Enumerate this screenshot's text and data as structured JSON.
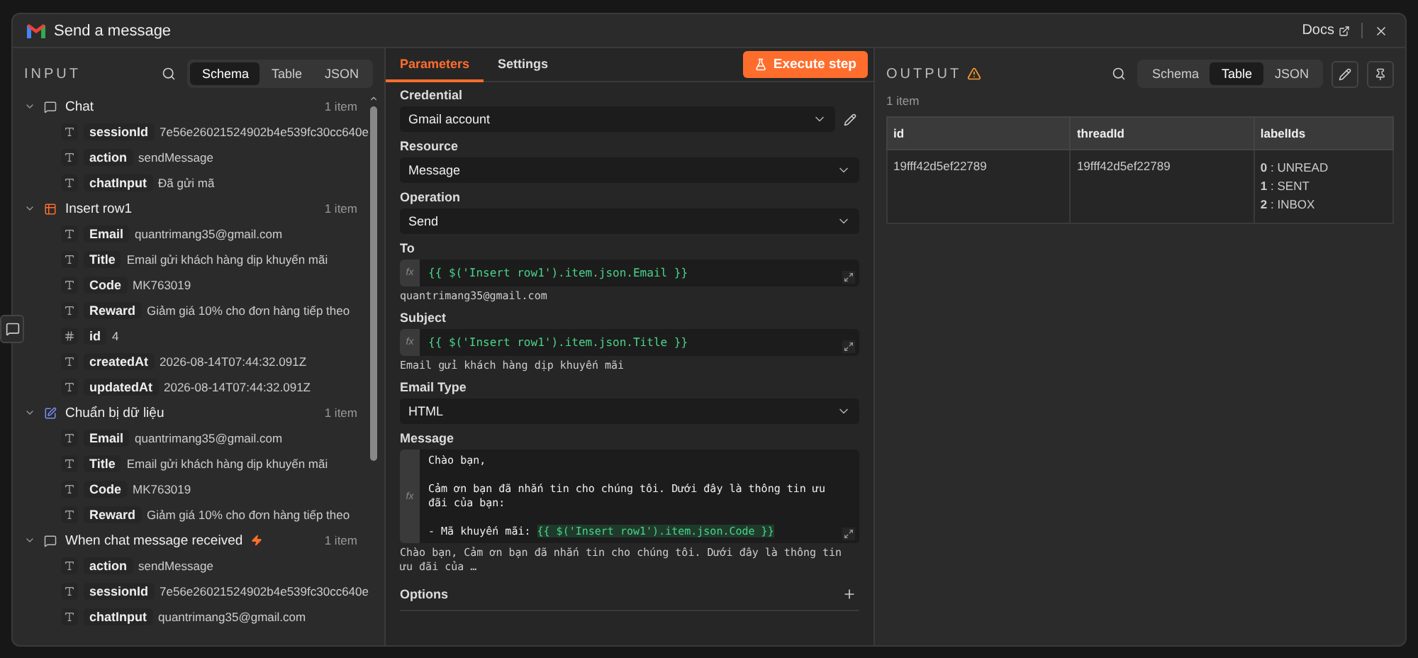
{
  "modal": {
    "title": "Send a message",
    "docs_link": "Docs"
  },
  "input": {
    "heading": "INPUT",
    "view_tabs": [
      {
        "label": "Schema",
        "selected": true
      },
      {
        "label": "Table",
        "selected": false
      },
      {
        "label": "JSON",
        "selected": false
      }
    ],
    "groups": [
      {
        "name": "Chat",
        "kind": "chat",
        "count": "1 item",
        "expanded": true,
        "fields": [
          {
            "kind": "string",
            "key": "sessionId",
            "value": "7e56e26021524902b4e539fc30cc640e"
          },
          {
            "kind": "string",
            "key": "action",
            "value": "sendMessage"
          },
          {
            "kind": "string",
            "key": "chatInput",
            "value": "Đã gửi mã"
          }
        ]
      },
      {
        "name": "Insert row1",
        "kind": "table",
        "count": "1 item",
        "expanded": true,
        "fields": [
          {
            "kind": "string",
            "key": "Email",
            "value": "quantrimang35@gmail.com"
          },
          {
            "kind": "string",
            "key": "Title",
            "value": "Email gửi khách hàng dịp khuyến mãi"
          },
          {
            "kind": "string",
            "key": "Code",
            "value": "MK763019"
          },
          {
            "kind": "string",
            "key": "Reward",
            "value": "Giảm giá 10% cho đơn hàng tiếp theo"
          },
          {
            "kind": "number",
            "key": "id",
            "value": "4"
          },
          {
            "kind": "string",
            "key": "createdAt",
            "value": "2026-08-14T07:44:32.091Z"
          },
          {
            "kind": "string",
            "key": "updatedAt",
            "value": "2026-08-14T07:44:32.091Z"
          }
        ]
      },
      {
        "name": "Chuẩn bị dữ liệu",
        "kind": "edit",
        "count": "1 item",
        "expanded": true,
        "fields": [
          {
            "kind": "string",
            "key": "Email",
            "value": "quantrimang35@gmail.com"
          },
          {
            "kind": "string",
            "key": "Title",
            "value": "Email gửi khách hàng dịp khuyến mãi"
          },
          {
            "kind": "string",
            "key": "Code",
            "value": "MK763019"
          },
          {
            "kind": "string",
            "key": "Reward",
            "value": "Giảm giá 10% cho đơn hàng tiếp theo"
          }
        ]
      },
      {
        "name": "When chat message received",
        "kind": "trigger",
        "count": "1 item",
        "expanded": true,
        "fields": [
          {
            "kind": "string",
            "key": "action",
            "value": "sendMessage"
          },
          {
            "kind": "string",
            "key": "sessionId",
            "value": "7e56e26021524902b4e539fc30cc640e"
          },
          {
            "kind": "string",
            "key": "chatInput",
            "value": "quantrimang35@gmail.com"
          }
        ]
      }
    ]
  },
  "parameters": {
    "tabs": [
      {
        "label": "Parameters",
        "selected": true
      },
      {
        "label": "Settings",
        "selected": false
      }
    ],
    "execute_button": "Execute step",
    "fields": [
      {
        "kind": "select",
        "label": "Credential",
        "value": "Gmail account",
        "editable": true
      },
      {
        "kind": "select",
        "label": "Resource",
        "value": "Message",
        "editable": false
      },
      {
        "kind": "select",
        "label": "Operation",
        "value": "Send",
        "editable": false
      },
      {
        "kind": "expression",
        "label": "To",
        "value": "{{ $('Insert row1').item.json.Email }}",
        "mode_label": "fx",
        "preview": "quantrimang35@gmail.com"
      },
      {
        "kind": "expression",
        "label": "Subject",
        "value": "{{ $('Insert row1').item.json.Title }}",
        "mode_label": "fx",
        "preview": "Email gửi khách hàng dịp khuyến mãi"
      },
      {
        "kind": "select",
        "label": "Email Type",
        "value": "HTML",
        "editable": false
      },
      {
        "kind": "code",
        "label": "Message",
        "lines": [
          {
            "kind": "text",
            "segments": [
              {
                "kind": "plain",
                "text": "Chào bạn,"
              }
            ]
          },
          {
            "kind": "blank"
          },
          {
            "kind": "text",
            "segments": [
              {
                "kind": "plain",
                "text": "Cảm ơn bạn đã nhắn tin cho chúng tôi. Dưới đây là thông tin ưu đãi của bạn:"
              }
            ]
          },
          {
            "kind": "blank"
          },
          {
            "kind": "text",
            "segments": [
              {
                "kind": "plain",
                "text": "- Mã khuyến mãi: "
              },
              {
                "kind": "expression",
                "text": "{{ $('Insert row1').item.json.Code }}"
              }
            ]
          }
        ],
        "mode_label": "fx",
        "preview": "Chào bạn, Cảm ơn bạn đã nhắn tin cho chúng tôi. Dưới đây là thông tin ưu đãi của …"
      }
    ],
    "options_label": "Options"
  },
  "output": {
    "heading": "OUTPUT",
    "warning": true,
    "view_tabs": [
      {
        "label": "Schema",
        "selected": false
      },
      {
        "label": "Table",
        "selected": true
      },
      {
        "label": "JSON",
        "selected": false
      }
    ],
    "count": "1 item",
    "table": {
      "columns": [
        "id",
        "threadId",
        "labelIds"
      ],
      "rows": [
        {
          "id": "19fff42d5ef22789",
          "threadId": "19fff42d5ef22789",
          "labelIds": [
            "**0** : UNREAD",
            "**1** : SENT",
            "**2** : INBOX"
          ]
        }
      ]
    }
  }
}
